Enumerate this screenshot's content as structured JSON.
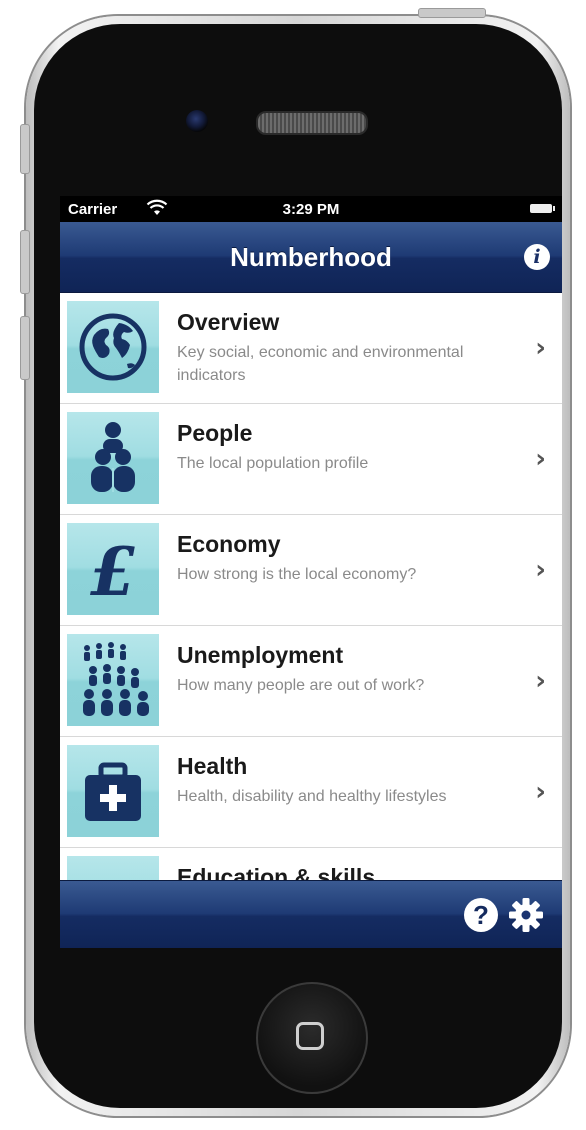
{
  "status_bar": {
    "carrier": "Carrier",
    "time": "3:29 PM"
  },
  "nav": {
    "title": "Numberhood"
  },
  "menu": [
    {
      "title": "Overview",
      "subtitle": "Key social, economic and environmental indicators",
      "icon": "globe-icon"
    },
    {
      "title": "People",
      "subtitle": "The local population profile",
      "icon": "people-icon"
    },
    {
      "title": "Economy",
      "subtitle": "How strong is the local economy?",
      "icon": "pound-icon"
    },
    {
      "title": "Unemployment",
      "subtitle": "How many people are out of work?",
      "icon": "crowd-icon"
    },
    {
      "title": "Health",
      "subtitle": "Health, disability and healthy lifestyles",
      "icon": "medical-kit-icon"
    },
    {
      "title": "Education & skills",
      "subtitle": "",
      "icon": "education-icon"
    }
  ],
  "toolbar": {
    "help_icon": "help-icon",
    "settings_icon": "gear-icon"
  },
  "colors": {
    "nav_bar": "#1e3a74",
    "icon_tile": "#a0dde2",
    "icon_fg": "#173263"
  }
}
